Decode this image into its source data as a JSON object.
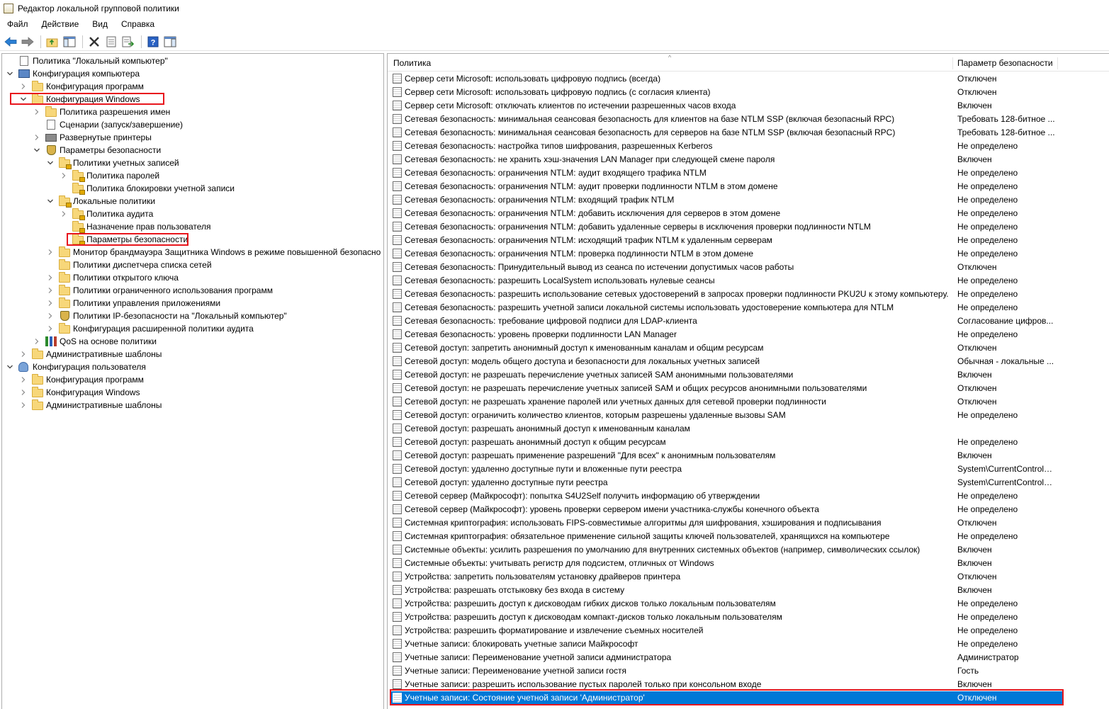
{
  "window": {
    "title": "Редактор локальной групповой политики",
    "app_icon": "policy-editor-icon"
  },
  "menu": [
    "Файл",
    "Действие",
    "Вид",
    "Справка"
  ],
  "toolbar": {
    "buttons": [
      "back-arrow-icon",
      "forward-arrow-icon",
      "up-folder-icon",
      "show-hide-tree-icon",
      "delete-icon",
      "properties-icon",
      "export-list-icon",
      "help-icon",
      "show-hide-action-pane-icon"
    ]
  },
  "tree": [
    {
      "label": "Политика \"Локальный компьютер\"",
      "icon": "doc",
      "level": 0,
      "chev": "none"
    },
    {
      "label": "Конфигурация компьютера",
      "icon": "computer",
      "level": 0,
      "chev": "down"
    },
    {
      "label": "Конфигурация программ",
      "icon": "folder",
      "level": 1,
      "chev": "right"
    },
    {
      "label": "Конфигурация Windows",
      "icon": "folder",
      "level": 1,
      "chev": "down"
    },
    {
      "label": "Политика разрешения имен",
      "icon": "folder",
      "level": 2,
      "chev": "right"
    },
    {
      "label": "Сценарии (запуск/завершение)",
      "icon": "doc",
      "level": 2,
      "chev": "none"
    },
    {
      "label": "Развернутые принтеры",
      "icon": "printer",
      "level": 2,
      "chev": "right"
    },
    {
      "label": "Параметры безопасности",
      "icon": "shield",
      "level": 2,
      "chev": "down"
    },
    {
      "label": "Политики учетных записей",
      "icon": "lockfolder",
      "level": 3,
      "chev": "down"
    },
    {
      "label": "Политика паролей",
      "icon": "lockfolder",
      "level": 4,
      "chev": "right"
    },
    {
      "label": "Политика блокировки учетной записи",
      "icon": "lockfolder",
      "level": 4,
      "chev": "none"
    },
    {
      "label": "Локальные политики",
      "icon": "lockfolder",
      "level": 3,
      "chev": "down"
    },
    {
      "label": "Политика аудита",
      "icon": "lockfolder",
      "level": 4,
      "chev": "right"
    },
    {
      "label": "Назначение прав пользователя",
      "icon": "lockfolder",
      "level": 4,
      "chev": "none"
    },
    {
      "label": "Параметры безопасности",
      "icon": "lockfolder",
      "level": 4,
      "chev": "none"
    },
    {
      "label": "Монитор брандмауэра Защитника Windows в режиме повышенной безопасно",
      "icon": "folder",
      "level": 3,
      "chev": "right"
    },
    {
      "label": "Политики диспетчера списка сетей",
      "icon": "folder",
      "level": 3,
      "chev": "none"
    },
    {
      "label": "Политики открытого ключа",
      "icon": "folder",
      "level": 3,
      "chev": "right"
    },
    {
      "label": "Политики ограниченного использования программ",
      "icon": "folder",
      "level": 3,
      "chev": "right"
    },
    {
      "label": "Политики управления приложениями",
      "icon": "folder",
      "level": 3,
      "chev": "right"
    },
    {
      "label": "Политики IP-безопасности на \"Локальный компьютер\"",
      "icon": "shield",
      "level": 3,
      "chev": "right"
    },
    {
      "label": "Конфигурация расширенной политики аудита",
      "icon": "folder",
      "level": 3,
      "chev": "right"
    },
    {
      "label": "QoS на основе политики",
      "icon": "chart",
      "level": 2,
      "chev": "right"
    },
    {
      "label": "Административные шаблоны",
      "icon": "folder",
      "level": 1,
      "chev": "right"
    },
    {
      "label": "Конфигурация пользователя",
      "icon": "user",
      "level": 0,
      "chev": "down"
    },
    {
      "label": "Конфигурация программ",
      "icon": "folder",
      "level": 1,
      "chev": "right"
    },
    {
      "label": "Конфигурация Windows",
      "icon": "folder",
      "level": 1,
      "chev": "right"
    },
    {
      "label": "Административные шаблоны",
      "icon": "folder",
      "level": 1,
      "chev": "right"
    }
  ],
  "list": {
    "col_policy": "Политика",
    "col_setting": "Параметр безопасности",
    "rows": [
      [
        "Сервер сети Microsoft: использовать цифровую подпись (всегда)",
        "Отключен"
      ],
      [
        "Сервер сети Microsoft: использовать цифровую подпись (с согласия клиента)",
        "Отключен"
      ],
      [
        "Сервер сети Microsoft: отключать клиентов по истечении разрешенных часов входа",
        "Включен"
      ],
      [
        "Сетевая безопасность: минимальная сеансовая безопасность для клиентов на базе NTLM SSP (включая безопасный RPC)",
        "Требовать 128-битное ..."
      ],
      [
        "Сетевая безопасность: минимальная сеансовая безопасность для серверов на базе NTLM SSP (включая безопасный RPC)",
        "Требовать 128-битное ..."
      ],
      [
        "Сетевая безопасность: настройка типов шифрования, разрешенных Kerberos",
        "Не определено"
      ],
      [
        "Сетевая безопасность: не хранить хэш-значения LAN Manager при следующей смене пароля",
        "Включен"
      ],
      [
        "Сетевая безопасность: ограничения NTLM: аудит входящего трафика NTLM",
        "Не определено"
      ],
      [
        "Сетевая безопасность: ограничения NTLM: аудит проверки подлинности NTLM в этом домене",
        "Не определено"
      ],
      [
        "Сетевая безопасность: ограничения NTLM: входящий трафик NTLM",
        "Не определено"
      ],
      [
        "Сетевая безопасность: ограничения NTLM: добавить исключения для серверов в этом домене",
        "Не определено"
      ],
      [
        "Сетевая безопасность: ограничения NTLM: добавить удаленные серверы в исключения проверки подлинности NTLM",
        "Не определено"
      ],
      [
        "Сетевая безопасность: ограничения NTLM: исходящий трафик NTLM к удаленным серверам",
        "Не определено"
      ],
      [
        "Сетевая безопасность: ограничения NTLM: проверка подлинности NTLM в этом домене",
        "Не определено"
      ],
      [
        "Сетевая безопасность: Принудительный вывод из сеанса по истечении допустимых часов работы",
        "Отключен"
      ],
      [
        "Сетевая безопасность: разрешить LocalSystem использовать нулевые сеансы",
        "Не определено"
      ],
      [
        "Сетевая безопасность: разрешить использование сетевых удостоверений в запросах проверки подлинности PKU2U к этому компьютеру.",
        "Не определено"
      ],
      [
        "Сетевая безопасность: разрешить учетной записи локальной системы использовать удостоверение компьютера для NTLM",
        "Не определено"
      ],
      [
        "Сетевая безопасность: требование цифровой подписи для LDAP-клиента",
        "Согласование цифров..."
      ],
      [
        "Сетевая безопасность: уровень проверки подлинности LAN Manager",
        "Не определено"
      ],
      [
        "Сетевой доступ: запретить анонимный доступ к именованным каналам и общим ресурсам",
        "Отключен"
      ],
      [
        "Сетевой доступ: модель общего доступа и безопасности для локальных учетных записей",
        "Обычная - локальные ..."
      ],
      [
        "Сетевой доступ: не разрешать перечисление учетных записей SAM анонимными пользователями",
        "Включен"
      ],
      [
        "Сетевой доступ: не разрешать перечисление учетных записей SAM и общих ресурсов анонимными пользователями",
        "Отключен"
      ],
      [
        "Сетевой доступ: не разрешать хранение паролей или учетных данных для сетевой проверки подлинности",
        "Отключен"
      ],
      [
        "Сетевой доступ: ограничить количество клиентов, которым разрешены удаленные вызовы SAM",
        "Не определено"
      ],
      [
        "Сетевой доступ: разрешать анонимный доступ к именованным каналам",
        ""
      ],
      [
        "Сетевой доступ: разрешать анонимный доступ к общим ресурсам",
        "Не определено"
      ],
      [
        "Сетевой доступ: разрешать применение разрешений \"Для всех\" к анонимным пользователям",
        "Включен"
      ],
      [
        "Сетевой доступ: удаленно доступные пути и вложенные пути реестра",
        "System\\CurrentControlS..."
      ],
      [
        "Сетевой доступ: удаленно доступные пути реестра",
        "System\\CurrentControlS..."
      ],
      [
        "Сетевой сервер (Майкрософт): попытка S4U2Self получить информацию об утверждении",
        "Не определено"
      ],
      [
        "Сетевой сервер (Майкрософт): уровень проверки сервером имени участника-службы конечного объекта",
        "Не определено"
      ],
      [
        "Системная криптография: использовать FIPS-совместимые алгоритмы для шифрования, хэширования и подписывания",
        "Отключен"
      ],
      [
        "Системная криптография: обязательное применение сильной защиты ключей пользователей, хранящихся на компьютере",
        "Не определено"
      ],
      [
        "Системные объекты: усилить разрешения по умолчанию для внутренних системных объектов (например, символических ссылок)",
        "Включен"
      ],
      [
        "Системные объекты: учитывать регистр для подсистем, отличных от Windows",
        "Включен"
      ],
      [
        "Устройства: запретить пользователям установку драйверов принтера",
        "Отключен"
      ],
      [
        "Устройства: разрешать отстыковку без входа в систему",
        "Включен"
      ],
      [
        "Устройства: разрешить доступ к дисководам гибких дисков только локальным пользователям",
        "Не определено"
      ],
      [
        "Устройства: разрешить доступ к дисководам компакт-дисков только локальным пользователям",
        "Не определено"
      ],
      [
        "Устройства: разрешить форматирование и извлечение съемных носителей",
        "Не определено"
      ],
      [
        "Учетные записи: блокировать учетные записи Майкрософт",
        "Не определено"
      ],
      [
        "Учетные записи: Переименование учетной записи администратора",
        "Администратор"
      ],
      [
        "Учетные записи: Переименование учетной записи гостя",
        "Гость"
      ],
      [
        "Учетные записи: разрешить использование пустых паролей только при консольном входе",
        "Включен"
      ],
      [
        "Учетные записи: Состояние учетной записи 'Администратор'",
        "Отключен"
      ]
    ],
    "selected_index": 46
  },
  "colors": {
    "selection": "#0078d7",
    "highlight_box": "#e8161d"
  }
}
